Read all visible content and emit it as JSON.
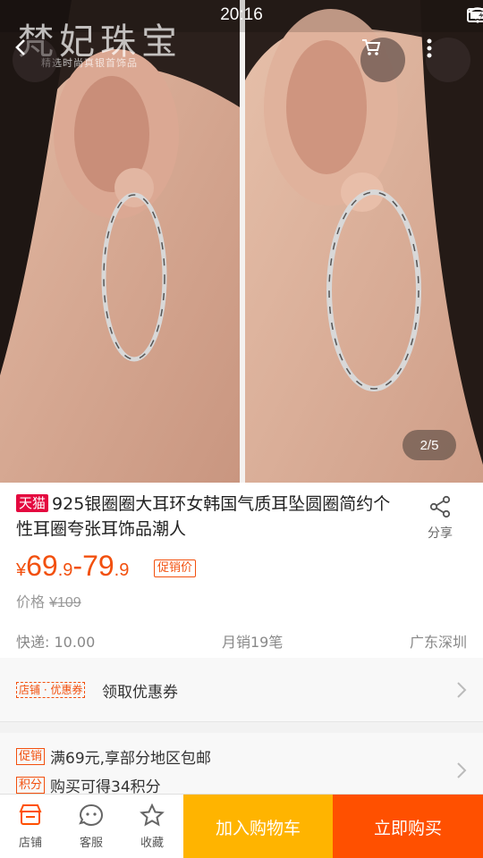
{
  "status": {
    "time": "20:16"
  },
  "photo": {
    "watermark": "梵妃珠宝",
    "watermark_sub": "精选时尚真银首饰品",
    "page_indicator": "2/5",
    "alt": "earring hoop worn on ear"
  },
  "product": {
    "badge": "天猫",
    "title": "925银圈圈大耳环女韩国气质耳坠圆圈简约个性耳圈夸张耳饰品潮人",
    "share_label": "分享",
    "price": {
      "currency": "¥",
      "low_int": "69",
      "low_dec": ".9",
      "dash": "-",
      "high_int": "79",
      "high_dec": ".9",
      "tag": "促销价"
    },
    "original_price_label": "价格",
    "original_price": "¥109",
    "shipping": "快递: 10.00",
    "monthly_sales": "月销19笔",
    "location": "广东深圳"
  },
  "coupon": {
    "tag": "店铺 · 优惠券",
    "text": "领取优惠券"
  },
  "promotions": [
    {
      "label": "促销",
      "text": "满69元,享部分地区包邮"
    },
    {
      "label": "积分",
      "text": "购买可得34积分"
    }
  ],
  "bottom_bar": {
    "shop": "店铺",
    "service": "客服",
    "favorite": "收藏",
    "add_to_cart": "加入购物车",
    "buy_now": "立即购买"
  },
  "colors": {
    "accent": "#f2500e",
    "tmall_red": "#e4093f",
    "cart_yellow": "#ffb400",
    "buy_orange": "#ff5000"
  }
}
